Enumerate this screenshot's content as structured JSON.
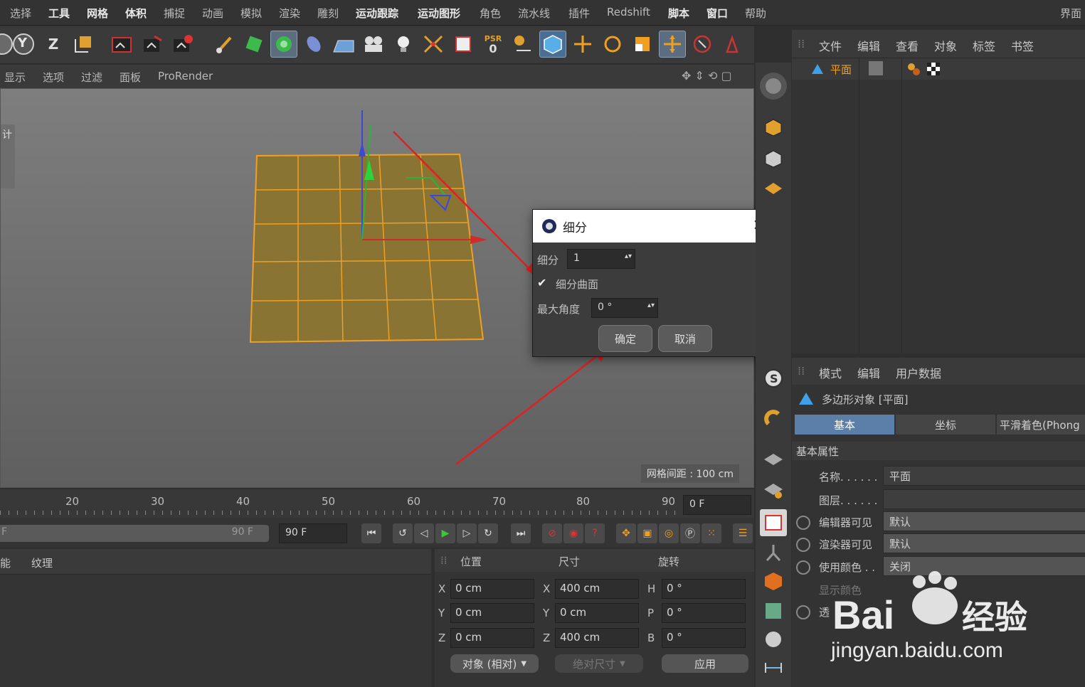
{
  "menubar": {
    "items": [
      "选择",
      "工具",
      "网格",
      "体积",
      "捕捉",
      "动画",
      "模拟",
      "渲染",
      "雕刻",
      "运动跟踪",
      "运动图形",
      "角色",
      "流水线",
      "插件",
      "Redshift",
      "脚本",
      "窗口",
      "帮助"
    ],
    "right": "界面"
  },
  "toolbar": {
    "axis_y": "Y",
    "axis_z": "Z",
    "psr_top": "PSR",
    "psr_bottom": "0"
  },
  "viewport_menu": {
    "items": [
      "显示",
      "选项",
      "过滤",
      "面板",
      "ProRender"
    ]
  },
  "viewport": {
    "grid_spacing": "网格间距 : 100 cm"
  },
  "dialog": {
    "title": "细分",
    "subdiv_label": "细分",
    "subdiv_value": "1",
    "surface_check": "✔",
    "surface_label": "细分曲面",
    "angle_label": "最大角度",
    "angle_value": "0 °",
    "ok": "确定",
    "cancel": "取消"
  },
  "object_panel": {
    "menu": [
      "文件",
      "编辑",
      "查看",
      "对象",
      "标签",
      "书签"
    ],
    "object_name": "平面"
  },
  "attr_panel": {
    "menu": [
      "模式",
      "编辑",
      "用户数据"
    ],
    "object_title": "多边形对象 [平面]",
    "tabs": [
      "基本",
      "坐标",
      "平滑着色(Phong"
    ],
    "section": "基本属性",
    "props": [
      {
        "label": "名称. . . . . .",
        "value": "平面"
      },
      {
        "label": "图层. . . . . .",
        "value": ""
      },
      {
        "label": "编辑器可见",
        "value": "默认"
      },
      {
        "label": "渲染器可见",
        "value": "默认"
      },
      {
        "label": "使用颜色 . .",
        "value": "关闭"
      },
      {
        "label": "显示颜色",
        "value": ""
      },
      {
        "label": "透",
        "value": ""
      }
    ]
  },
  "timeline": {
    "ticks": [
      "20",
      "30",
      "40",
      "50",
      "60",
      "70",
      "80",
      "90"
    ],
    "current_frame": "0 F"
  },
  "transport": {
    "left_label": "F",
    "end_frame_slider": "90 F",
    "end_frame": "90 F"
  },
  "material_panel": {
    "menu": [
      "能",
      "纹理"
    ]
  },
  "coord_panel": {
    "headers": [
      "位置",
      "尺寸",
      "旋转"
    ],
    "rows": [
      {
        "axis": "X",
        "pos": "0 cm",
        "size_axis": "X",
        "size": "400 cm",
        "rot_axis": "H",
        "rot": "0 °"
      },
      {
        "axis": "Y",
        "pos": "0 cm",
        "size_axis": "Y",
        "size": "0 cm",
        "rot_axis": "P",
        "rot": "0 °"
      },
      {
        "axis": "Z",
        "pos": "0 cm",
        "size_axis": "Z",
        "size": "400 cm",
        "rot_axis": "B",
        "rot": "0 °"
      }
    ],
    "mode_select": "对象 (相对)",
    "size_select": "绝对尺寸",
    "apply": "应用"
  },
  "left_panel_hint": "计",
  "watermark": {
    "brand": "Bai",
    "brand_cn": "经验",
    "url": "jingyan.baidu.com"
  },
  "colors": {
    "accent_orange": "#f0a020",
    "active_blue": "#5b7fa8",
    "arrow_red": "#e02020"
  }
}
